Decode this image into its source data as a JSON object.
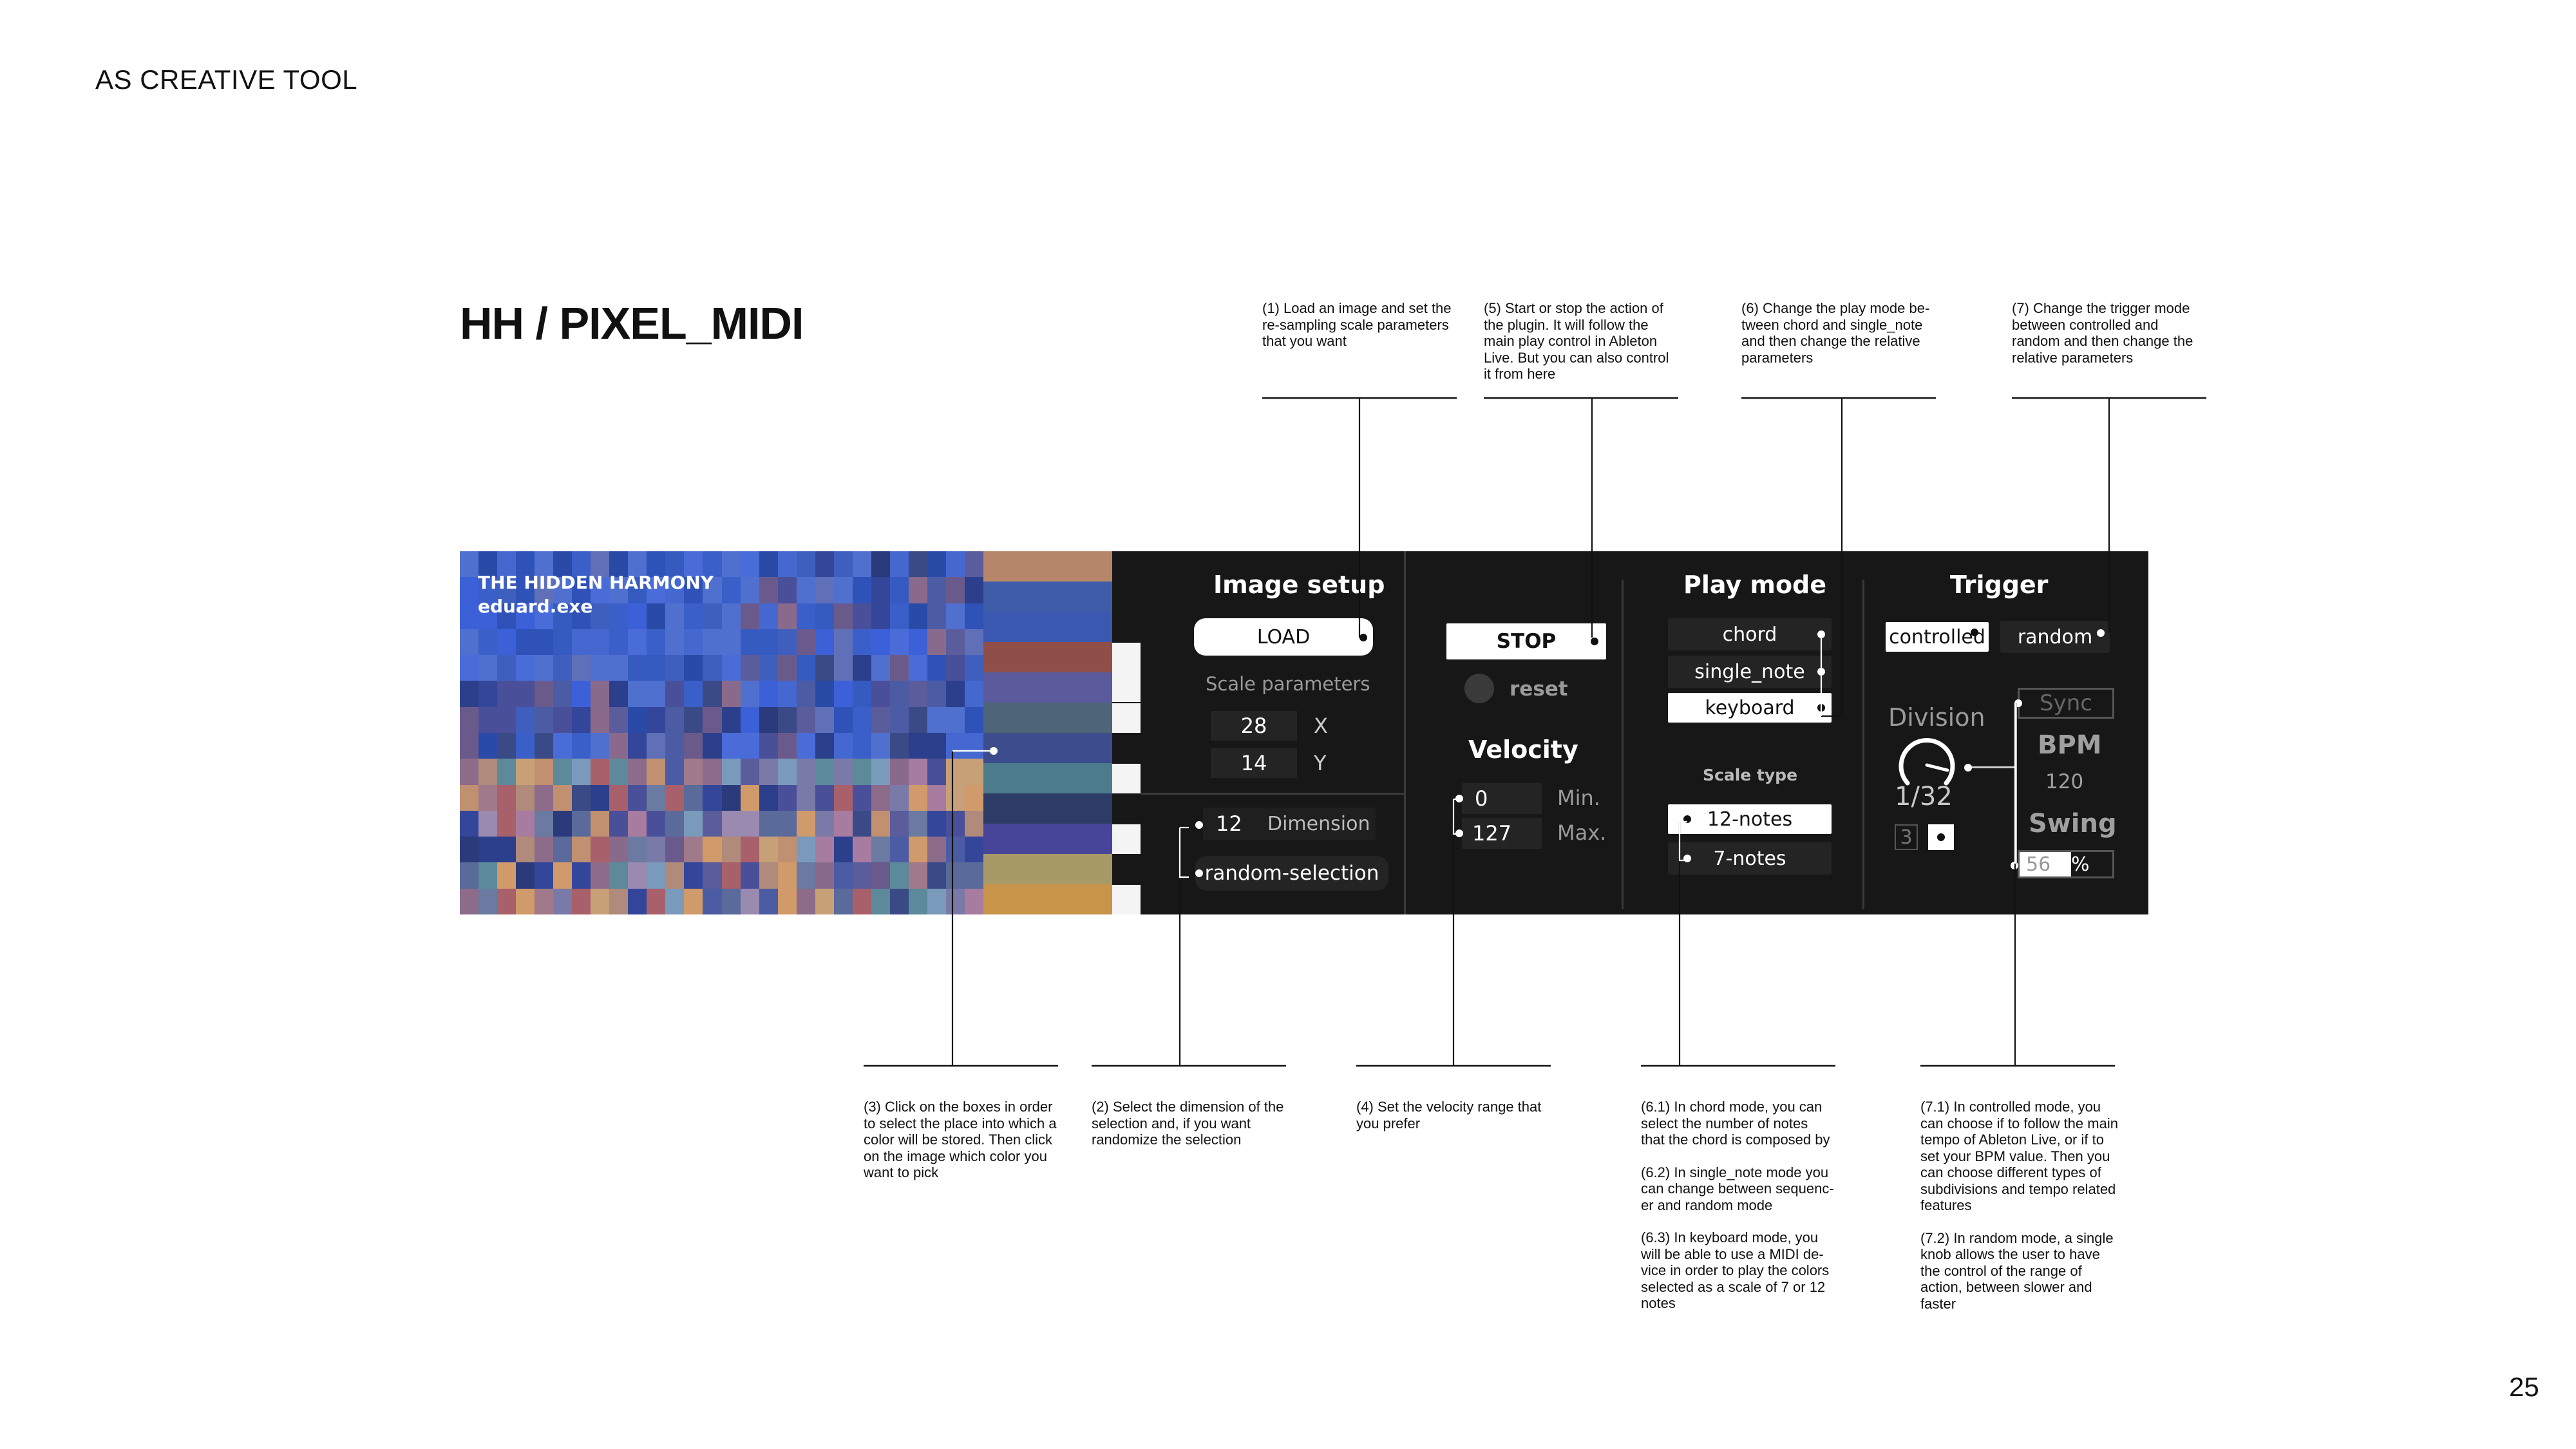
{
  "section_label": "AS CREATIVE TOOL",
  "title": "HH / PIXEL_MIDI",
  "page_number": "25",
  "image": {
    "title_line1": "THE HIDDEN HARMONY",
    "title_line2": "eduard.exe"
  },
  "image_setup": {
    "heading": "Image setup",
    "load_label": "LOAD",
    "scale_label": "Scale parameters",
    "x_value": "28",
    "x_label": "X",
    "y_value": "14",
    "y_label": "Y",
    "dimension_value": "12",
    "dimension_label": "Dimension",
    "random_selection_label": "random-selection"
  },
  "transport": {
    "stop_label": "STOP",
    "reset_label": "reset",
    "velocity_heading": "Velocity",
    "min_value": "0",
    "min_label": "Min.",
    "max_value": "127",
    "max_label": "Max."
  },
  "play_mode": {
    "heading": "Play mode",
    "options": [
      "chord",
      "single_note",
      "keyboard"
    ],
    "selected": "keyboard",
    "scale_type_label": "Scale type",
    "scale_options": [
      "12-notes",
      "7-notes"
    ],
    "scale_selected": "12-notes"
  },
  "trigger": {
    "heading": "Trigger",
    "options": [
      "controlled",
      "random"
    ],
    "selected": "controlled",
    "division_label": "Division",
    "division_value": "1/32",
    "triplet_label": "3",
    "sync_label": "Sync",
    "bpm_label": "BPM",
    "bpm_value": "120",
    "swing_label": "Swing",
    "swing_value": "56",
    "swing_unit": "%"
  },
  "annotations": {
    "n1": "(1) Load an image and set the re-sampling scale parameters that you want",
    "n5": "(5) Start or stop the action of the plugin. It will follow the main play control in Ableton Live. But you can also control it from here",
    "n6": "(6) Change the play mode be-tween chord and single_note and then change the relative parameters",
    "n7": "(7) Change the trigger mode between controlled and random and then change the relative parameters",
    "n3": "(3) Click on the boxes in order to select the place into which a color will be stored. Then click on the image which color you want to pick",
    "n2": "(2) Select the dimension of the selection and, if you want randomize the selection",
    "n4": "(4) Set the velocity range that you prefer",
    "n6_1": "(6.1) In chord mode, you can select the number of notes that the chord is composed by",
    "n6_2": "(6.2) In single_note mode you can change between sequenc-er and random mode",
    "n6_3": "(6.3) In keyboard mode, you will be able to use a MIDI de-vice in order to play the colors selected as a scale of 7 or 12 notes",
    "n7_1": "(7.1) In controlled mode, you can choose if to follow the main tempo of Ableton Live, or if to set your BPM value. Then you can choose different types of subdivisions and tempo related features",
    "n7_2": "(7.2) In random mode, a single knob allows the user to have the control of the range of action, between slower and faster"
  },
  "colors": {
    "panel_bg": "#171717",
    "control_bg": "#242424",
    "swatches": [
      "#b5866a",
      "#3e5ca8",
      "#3a58b0",
      "#8f4f48",
      "#5b5a9c",
      "#4e6478",
      "#3c4c8c",
      "#4c7c8c",
      "#2c3c66",
      "#46459a",
      "#a89a66",
      "#c8944a"
    ]
  }
}
